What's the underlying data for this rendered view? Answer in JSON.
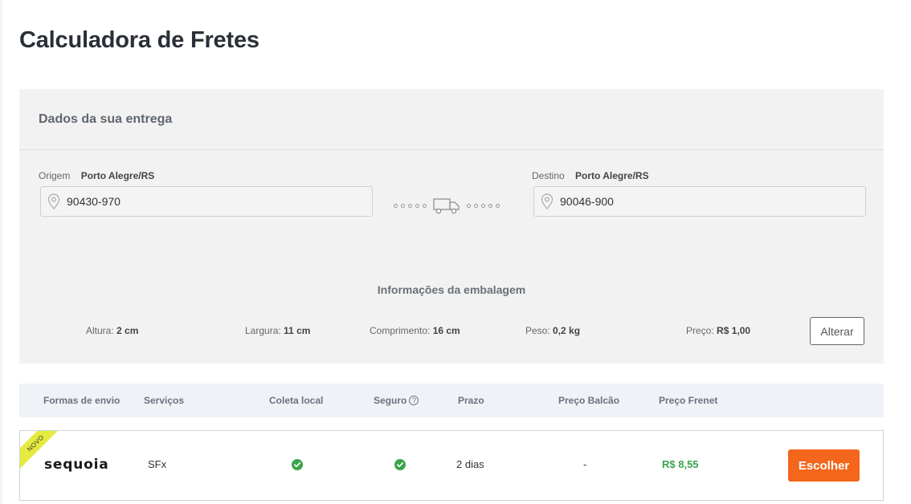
{
  "page": {
    "title": "Calculadora de Fretes"
  },
  "delivery": {
    "title": "Dados da sua entrega",
    "origin": {
      "label": "Origem",
      "city": "Porto Alegre/RS",
      "zip": "90430-970"
    },
    "destination": {
      "label": "Destino",
      "city": "Porto Alegre/RS",
      "zip": "90046-900"
    },
    "icons": {
      "pin": "location-pin-icon",
      "truck": "truck-icon"
    }
  },
  "package": {
    "title": "Informações da embalagem",
    "height": {
      "label": "Altura:",
      "value": "2 cm"
    },
    "width": {
      "label": "Largura:",
      "value": "11 cm"
    },
    "length": {
      "label": "Comprimento:",
      "value": "16 cm"
    },
    "weight": {
      "label": "Peso:",
      "value": "0,2 kg"
    },
    "price": {
      "label": "Preço:",
      "value": "R$ 1,00"
    },
    "alter_label": "Alterar"
  },
  "table": {
    "headers": {
      "shipping": "Formas de envio",
      "services": "Serviços",
      "local_pickup": "Coleta local",
      "insurance": "Seguro",
      "insurance_help": "?",
      "deadline": "Prazo",
      "counter_price": "Preço Balcão",
      "frenet_price": "Preço Frenet"
    },
    "rows": [
      {
        "badge": "NOVO",
        "carrier": "sequoia",
        "service": "SFx",
        "local_pickup": true,
        "insurance": true,
        "deadline": "2 dias",
        "counter_price": "-",
        "frenet_price": "R$ 8,55",
        "action": "Escolher"
      }
    ]
  },
  "colors": {
    "accent": "#f4661b",
    "success": "#3aa54b",
    "badge": "#e5ea3f",
    "panel": "#f2f2f2",
    "table_header": "#eff2f7"
  }
}
